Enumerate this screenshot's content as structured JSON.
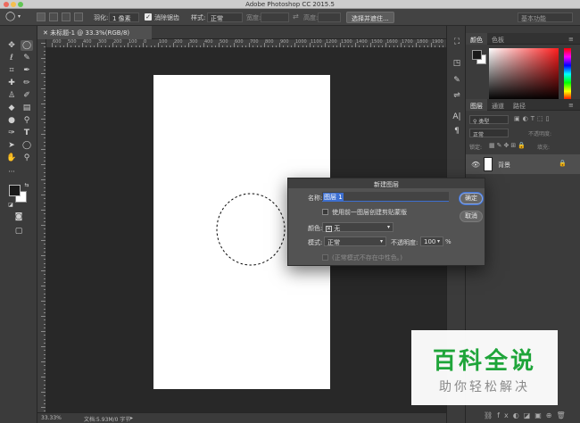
{
  "window": {
    "title": "Adobe Photoshop CC 2015.5"
  },
  "options_bar": {
    "feather_label": "羽化:",
    "feather_value": "1 像素",
    "antialias_label": "消除锯齿",
    "style_label": "样式:",
    "style_value": "正常",
    "width_label": "宽度:",
    "height_label": "高度:",
    "select_mask_button": "选择并遮住...",
    "workspace_label": "基本功能"
  },
  "document": {
    "tab_label": "未标题-1 @ 33.3%(RGB/8)",
    "ruler_numbers": [
      "600",
      "500",
      "400",
      "300",
      "200",
      "100",
      "0",
      "100",
      "200",
      "300",
      "400",
      "500",
      "600",
      "700",
      "800",
      "900",
      "1000",
      "1100",
      "1200",
      "1300",
      "1400",
      "1500",
      "1600",
      "1700",
      "1800",
      "1900"
    ]
  },
  "status_bar": {
    "zoom": "33.33%",
    "doc_info": "文档:5.93M/0 字节"
  },
  "color_panel": {
    "tabs": [
      "颜色",
      "色板"
    ],
    "foreground": "#1a1a1a",
    "background": "#ffffff"
  },
  "layers_panel": {
    "tabs": [
      "图层",
      "通道",
      "路径"
    ],
    "kind_filter": "类型",
    "blend_mode": "正常",
    "opacity_label": "不透明度:",
    "lock_label": "锁定:",
    "fill_label": "填充:",
    "layer_name": "背景"
  },
  "dialog": {
    "title": "新建图层",
    "name_label": "名称:",
    "name_value": "图层 1",
    "clip_checkbox_label": "使用前一图层创建剪贴蒙版",
    "color_label": "颜色:",
    "color_value": "无",
    "mode_label": "模式:",
    "mode_value": "正常",
    "opacity_label": "不透明度:",
    "opacity_value": "100",
    "opacity_unit": "%",
    "neutral_note": "(正常模式不存在中性色。)",
    "ok_button": "确定",
    "cancel_button": "取消"
  },
  "watermark": {
    "title": "百科全说",
    "subtitle": "助你轻松解决"
  }
}
